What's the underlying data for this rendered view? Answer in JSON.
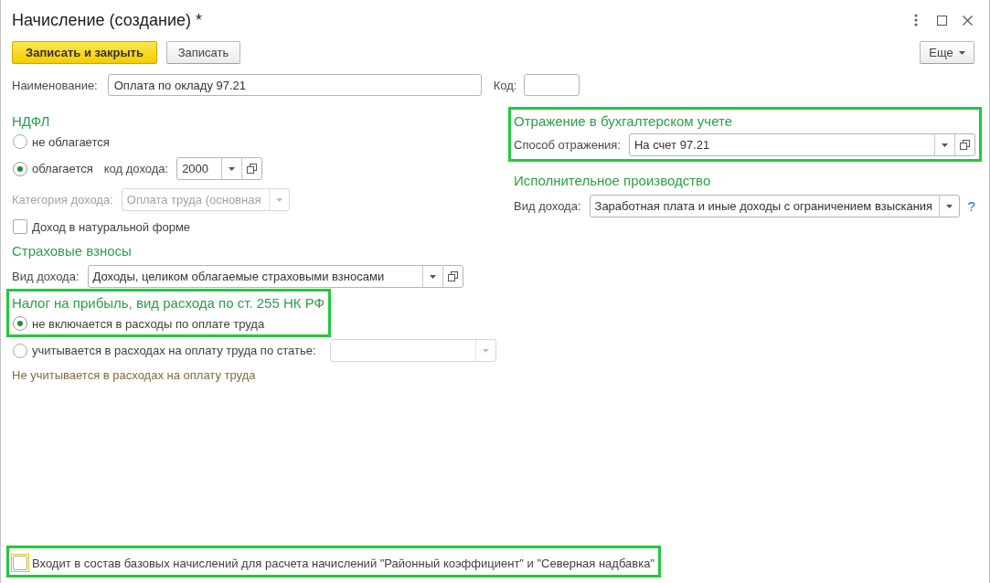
{
  "window": {
    "title": "Начисление (создание) *"
  },
  "toolbar": {
    "buttons": [
      {
        "label": "Записать и закрыть",
        "kind": "primary"
      },
      {
        "label": "Записать",
        "kind": "default"
      }
    ],
    "more": {
      "label": "Еще"
    }
  },
  "name_row": {
    "name": {
      "label": "Наименование:",
      "value": "Оплата по окладу 97.21"
    },
    "code": {
      "label": "Код:"
    }
  },
  "ndfl": {
    "title": "НДФЛ",
    "options": [
      {
        "label": "не облагается",
        "selected": false
      },
      {
        "label": "облагается",
        "selected": true,
        "field": {
          "label": "код дохода:",
          "value": "2000",
          "open_button": true
        }
      }
    ],
    "category": {
      "label": "Категория дохода:",
      "value": "Оплата труда (основная",
      "disabled": true
    },
    "in_kind": {
      "label": "Доход в натуральной форме",
      "checked": false
    }
  },
  "insurance": {
    "title": "Страховые взносы",
    "field": {
      "label": "Вид дохода:",
      "value": "Доходы, целиком облагаемые страховыми взносами",
      "open_button": true
    }
  },
  "profit_tax": {
    "title": "Налог на прибыль, вид расхода по ст. 255 НК РФ",
    "highlighted": true,
    "options": [
      {
        "label": "не включается в расходы по оплате труда",
        "selected": true,
        "highlighted": true
      },
      {
        "label": "учитывается в расходах на оплату труда по статье:",
        "selected": false,
        "field": {
          "disabled": true
        }
      }
    ],
    "note": "Не учитывается в расходах на оплату труда"
  },
  "accounting": {
    "title": "Отражение в бухгалтерском учете",
    "highlighted": true,
    "field": {
      "label": "Способ отражения:",
      "value": "На счет 97.21",
      "open_button": true
    }
  },
  "enforcement": {
    "title": "Исполнительное производство",
    "field": {
      "label": "Вид дохода:",
      "value": "Заработная плата и иные доходы с ограничением взыскания",
      "help": "?"
    }
  },
  "base_accruals": {
    "label": "Входит в состав базовых начислений для расчета начислений \"Районный коэффициент\" и \"Северная надбавка\"",
    "checked": false,
    "focused": true,
    "highlighted": true
  }
}
